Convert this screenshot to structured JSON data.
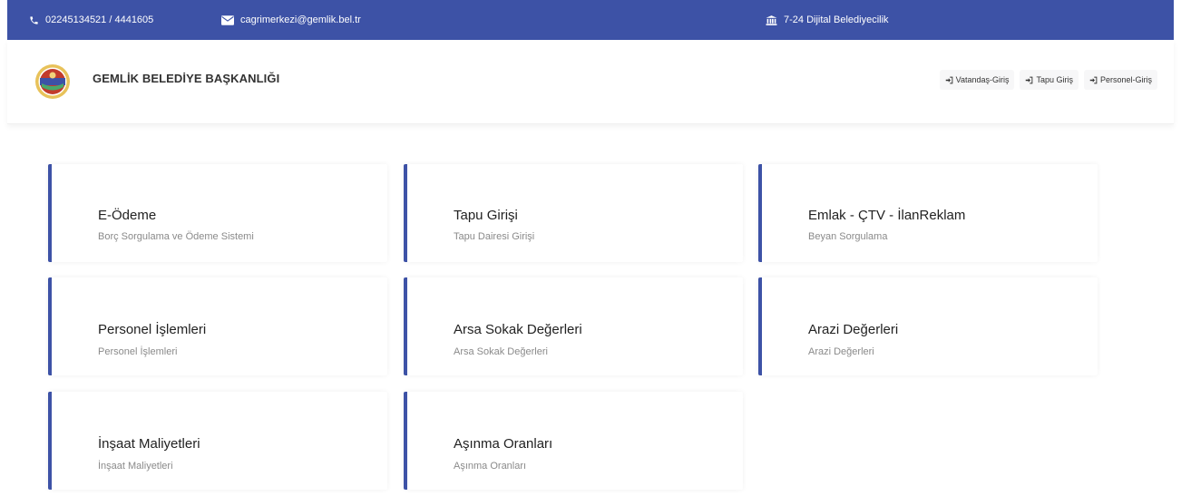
{
  "topbar": {
    "phone": "02245134521 / 4441605",
    "email": "cagrimerkezi@gemlik.bel.tr",
    "digital": "7-24 Dijital Belediyecilik"
  },
  "header": {
    "brand": "GEMLİK BELEDİYE BAŞKANLIĞI",
    "logins": [
      {
        "label": "Vatandaş-Giriş"
      },
      {
        "label": "Tapu Giriş"
      },
      {
        "label": "Personel-Giriş"
      }
    ]
  },
  "cards": [
    {
      "title": "E-Ödeme",
      "subtitle": "Borç Sorgulama ve Ödeme Sistemi"
    },
    {
      "title": "Tapu Girişi",
      "subtitle": "Tapu Dairesi Girişi"
    },
    {
      "title": "Emlak - ÇTV - İlanReklam",
      "subtitle": "Beyan Sorgulama"
    },
    {
      "title": "Personel İşlemleri",
      "subtitle": "Personel İşlemleri"
    },
    {
      "title": "Arsa Sokak Değerleri",
      "subtitle": "Arsa Sokak Değerleri"
    },
    {
      "title": "Arazi Değerleri",
      "subtitle": "Arazi Değerleri"
    },
    {
      "title": "İnşaat Maliyetleri",
      "subtitle": "İnşaat Maliyetleri"
    },
    {
      "title": "Aşınma Oranları",
      "subtitle": "Aşınma Oranları"
    }
  ],
  "colors": {
    "accent": "#3d52a6",
    "subtitle": "#8a8a8a"
  },
  "icons": {
    "phone": "phone-icon",
    "email": "envelope-icon",
    "digital": "bank-building-icon",
    "login": "sign-in-icon",
    "logo": "municipality-seal-logo"
  }
}
